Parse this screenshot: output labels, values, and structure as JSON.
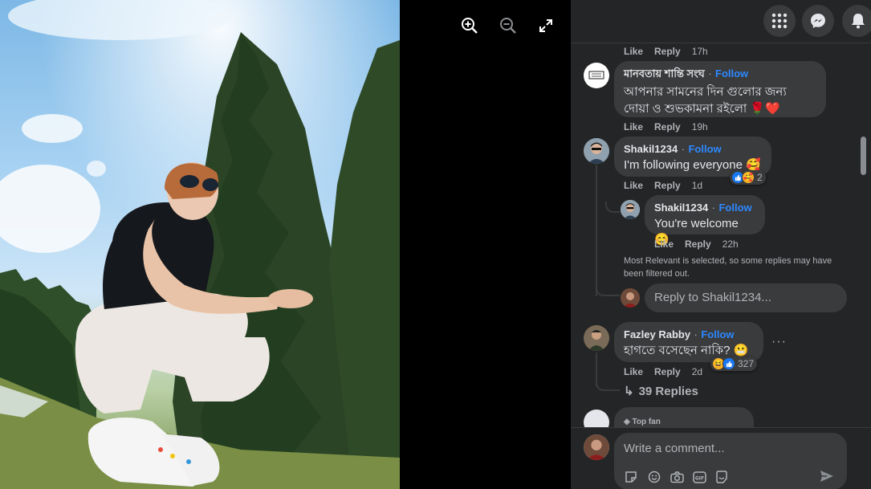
{
  "viewer": {
    "zoom_in_icon": "zoom-in-icon",
    "zoom_out_icon": "zoom-out-icon",
    "fullscreen_icon": "fullscreen-icon"
  },
  "topbar": {
    "menu_icon": "grid-menu-icon",
    "messenger_icon": "messenger-icon",
    "notifications_icon": "bell-icon"
  },
  "comments": {
    "prev_actions": {
      "like": "Like",
      "reply": "Reply",
      "time": "17h"
    },
    "items": [
      {
        "author": "মানবতায় শান্তি সংঘ",
        "follow": "Follow",
        "text_line1": "আপনার সামনের দিন গুলোর জন্য",
        "text_line2": "দোয়া ও শুভকামনা রইলো 🌹❤️",
        "like": "Like",
        "reply": "Reply",
        "time": "19h"
      },
      {
        "author": "Shakil1234",
        "follow": "Follow",
        "text": "I'm following everyone 🥰",
        "reaction_count": "2",
        "like": "Like",
        "reply": "Reply",
        "time": "1d",
        "replies": [
          {
            "author": "Shakil1234",
            "follow": "Follow",
            "text": "You're welcome 😊",
            "like": "Like",
            "reply": "Reply",
            "time": "22h"
          }
        ],
        "filter_note_line1": "Most Relevant is selected, so some replies may have",
        "filter_note_line2": "been filtered out.",
        "reply_placeholder": "Reply to Shakil1234..."
      },
      {
        "author": "Fazley Rabby",
        "follow": "Follow",
        "text": "হাগতে বসেছেন নাকি? 😬",
        "reaction_count": "327",
        "like": "Like",
        "reply": "Reply",
        "time": "2d",
        "more_replies": "39 Replies",
        "more_options": "···"
      },
      {
        "badge": "Top fan"
      }
    ]
  },
  "composer": {
    "placeholder": "Write a comment...",
    "icons": [
      "sticker-icon",
      "emoji-icon",
      "camera-icon",
      "gif-icon",
      "avatar-sticker-icon"
    ],
    "send_icon": "send-icon"
  },
  "colors": {
    "pane_bg": "#242526",
    "bubble_bg": "#3a3b3c",
    "text": "#e4e6eb",
    "secondary": "#b0b3b8",
    "accent": "#2d88ff"
  }
}
